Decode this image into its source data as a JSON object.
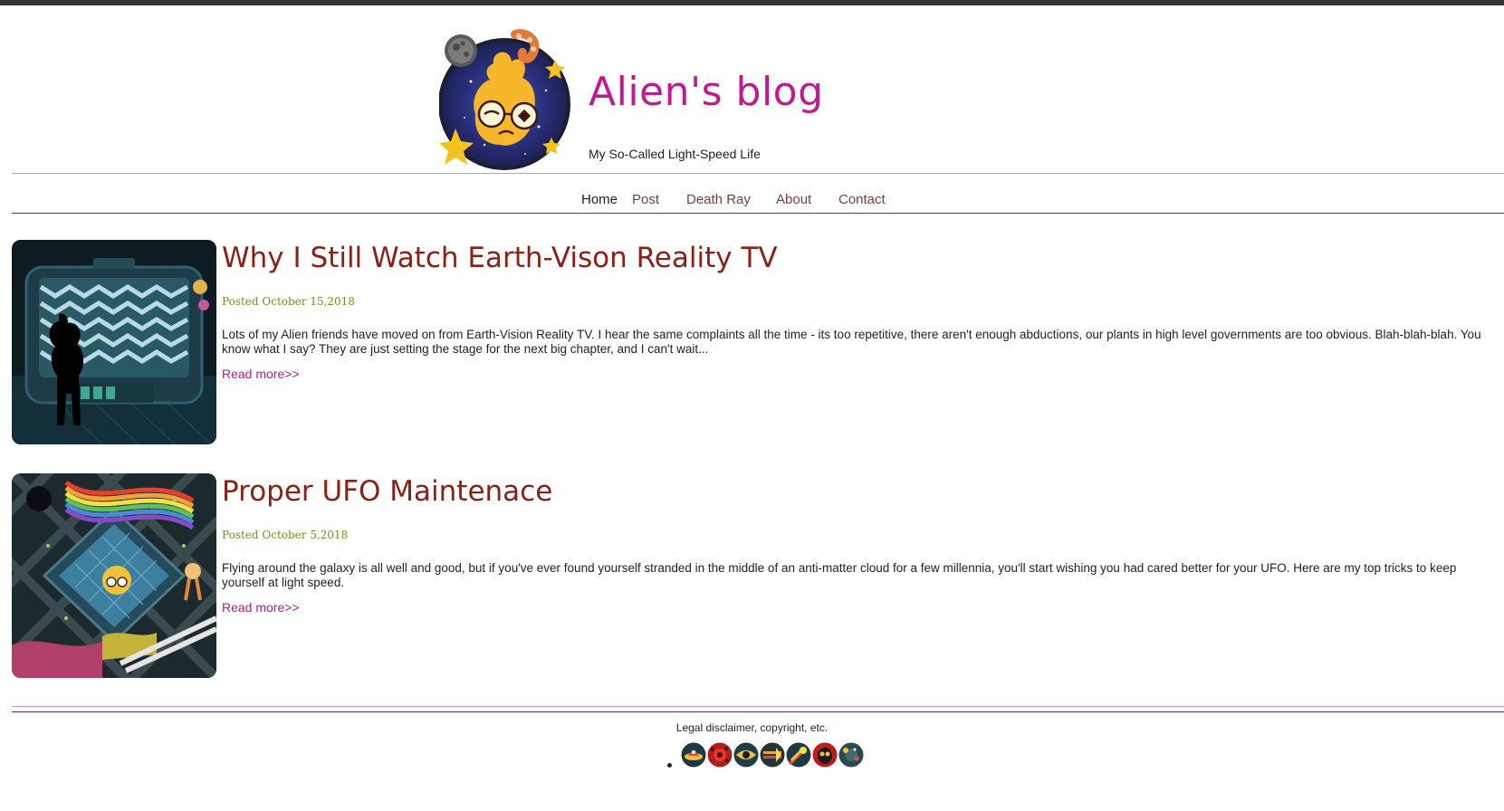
{
  "site": {
    "title": "Alien's blog",
    "tagline": "My So-Called Light-Speed Life",
    "accent_color": "#c01a91",
    "post_title_color": "#8b2015",
    "date_color": "#7e8a1e"
  },
  "nav": {
    "items": [
      {
        "label": "Home",
        "active": true
      },
      {
        "label": "Post"
      },
      {
        "label": "Death Ray"
      },
      {
        "label": "About"
      },
      {
        "label": "Contact"
      }
    ]
  },
  "posts": [
    {
      "title": "Why I Still Watch Earth-Vison Reality TV",
      "date": "Posted October 15,2018",
      "excerpt": "Lots of my Alien friends have moved on from Earth-Vision Reality TV. I hear the same complaints all the time - its too repetitive, there aren't enough abductions, our plants in high level governments are too obvious. Blah-blah-blah. You know what I say? They are just setting the stage for the next big chapter, and I can't wait...",
      "read_more": "Read more>>",
      "image_icon": "alien-watching-tv-illustration"
    },
    {
      "title": "Proper UFO Maintenace",
      "date": "Posted October 5,2018",
      "excerpt": "Flying around the galaxy is all well and good, but if you've ever found yourself stranded in the middle of an anti-matter cloud for a few millennia, you'll start wishing you had cared better for your UFO. Here are my top tricks to keep yourself at light speed.",
      "read_more": "Read more>>",
      "image_icon": "ufo-maintenance-illustration"
    }
  ],
  "footer": {
    "text": "Legal disclaimer, copyright, etc.",
    "icons": [
      "ufo-icon",
      "virus-icon",
      "eye-icon",
      "rocket-icon",
      "comet-icon",
      "alien-face-icon",
      "planet-icon"
    ]
  }
}
